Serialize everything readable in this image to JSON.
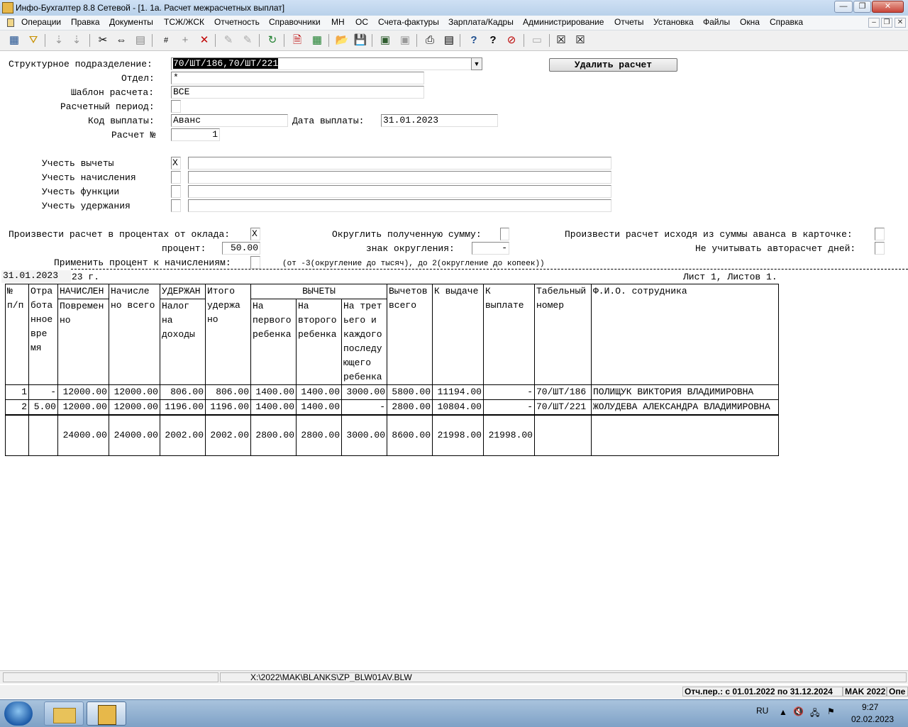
{
  "window": {
    "title": "Инфо-Бухгалтер 8.8 Сетевой - [1. 1а. Расчет межрасчетных выплат]",
    "controls": [
      "—",
      "❐",
      "✕"
    ]
  },
  "menu": [
    "Операции",
    "Правка",
    "Документы",
    "ТСЖ/ЖСК",
    "Отчетность",
    "Справочники",
    "МН",
    "ОС",
    "Счета-фактуры",
    "Зарплата/Кадры",
    "Администрирование",
    "Отчеты",
    "Установка",
    "Файлы",
    "Окна",
    "Справка"
  ],
  "mdi_controls": [
    "–",
    "❐",
    "✕"
  ],
  "toolbar": [
    {
      "name": "grid-icon",
      "glyph": "▦"
    },
    {
      "name": "filter-icon",
      "glyph": "⛛"
    },
    {
      "name": "sort-asc-icon",
      "glyph": "⇣"
    },
    {
      "name": "sort-desc-icon",
      "glyph": "⇣"
    },
    {
      "name": "copy-icon",
      "glyph": "❐"
    },
    {
      "name": "cut-icon",
      "glyph": "✂"
    },
    {
      "name": "move-icon",
      "glyph": "⇔"
    },
    {
      "name": "paste-icon",
      "glyph": "▤"
    },
    {
      "name": "number-icon",
      "glyph": "#"
    },
    {
      "name": "add-icon",
      "glyph": "+"
    },
    {
      "name": "delete-icon",
      "glyph": "✕"
    },
    {
      "name": "tool-icon",
      "glyph": "✎"
    },
    {
      "name": "tool2-icon",
      "glyph": "✎"
    },
    {
      "name": "refresh-icon",
      "glyph": "↻"
    },
    {
      "name": "document-icon",
      "glyph": "🗎"
    },
    {
      "name": "calculator-icon",
      "glyph": "▦"
    },
    {
      "name": "open-folder-icon",
      "glyph": "📂"
    },
    {
      "name": "save-icon",
      "glyph": "💾"
    },
    {
      "name": "export-icon",
      "glyph": "▣"
    },
    {
      "name": "import-icon",
      "glyph": "▣"
    },
    {
      "name": "print-icon",
      "glyph": "⎙"
    },
    {
      "name": "preview-icon",
      "glyph": "▤"
    },
    {
      "name": "help-icon",
      "glyph": "?"
    },
    {
      "name": "context-help-icon",
      "glyph": "?"
    },
    {
      "name": "compass-icon",
      "glyph": "⊘"
    },
    {
      "name": "report-icon",
      "glyph": "▭"
    },
    {
      "name": "close-doc-icon",
      "glyph": "☒"
    },
    {
      "name": "close-all-icon",
      "glyph": "☒"
    }
  ],
  "form": {
    "division_label": "Структурное подразделение:",
    "division_value": "70/ШТ/186,70/ШТ/221",
    "delete_button": "Удалить расчет",
    "dept_label": "Отдел:",
    "dept_value": "*",
    "template_label": "Шаблон расчета:",
    "template_value": "ВСЕ",
    "period_label": "Расчетный период:",
    "period_value": "",
    "paycode_label": "Код выплаты:",
    "paycode_value": "Аванс",
    "paydate_label": "Дата выплаты:",
    "paydate_value": "31.01.2023",
    "calcno_label": "Расчет №",
    "calcno_value": "1",
    "checks": [
      {
        "label": "Учесть вычеты",
        "mark": "X",
        "text": ""
      },
      {
        "label": "Учесть начисления",
        "mark": "",
        "text": ""
      },
      {
        "label": "Учесть функции",
        "mark": "",
        "text": ""
      },
      {
        "label": "Учесть удержания",
        "mark": "",
        "text": ""
      }
    ],
    "percent_calc_label": "Произвести расчет в процентах от оклада:",
    "percent_calc_mark": "X",
    "round_label": "Округлить полученную сумму:",
    "round_mark": "",
    "advance_card_label": "Произвести расчет исходя из суммы аванса в карточке:",
    "advance_card_mark": "",
    "percent_label": "процент:",
    "percent_value": "50.00",
    "round_sign_label": "знак округления:",
    "round_sign_value": "-",
    "no_autocalc_label": "Не учитывать авторасчет дней:",
    "no_autocalc_mark": "",
    "apply_percent_label": "Применить процент к начислениям:",
    "apply_percent_mark": "",
    "round_hint": "(от -3(округление до тысяч), до 2(округление до копеек))"
  },
  "report": {
    "date_field": "31.01.2023",
    "date_suffix": "23 г.",
    "sheet_info": "Лист 1, Листов 1.",
    "headers": {
      "no": "№ п/п",
      "worked": "Отра бота нное вре мя",
      "accrued_group": "НАЧИСЛЕН",
      "accrued_time": "Повремен но",
      "accrued_total": "Начисле но всего",
      "withheld_group": "УДЕРЖАН",
      "income_tax": "Налог на доходы",
      "withheld_total": "Итого удержа но",
      "deductions_group": "ВЫЧЕТЫ",
      "first_child": "На первого ребенка",
      "second_child": "На второго ребенка",
      "third_child": "На трет ьего и каждого последу ющего ребенка",
      "deductions_total": "Вычетов всего",
      "to_issue": "К выдаче",
      "to_pay": "К выплате",
      "tab_no": "Табельный номер",
      "fio": "Ф.И.О. сотрудника"
    },
    "rows": [
      [
        "1",
        "-",
        "12000.00",
        "12000.00",
        "806.00",
        "806.00",
        "1400.00",
        "1400.00",
        "3000.00",
        "5800.00",
        "11194.00",
        "-",
        "70/ШТ/186",
        "ПОЛИЩУК ВИКТОРИЯ ВЛАДИМИРОВНА"
      ],
      [
        "2",
        "5.00",
        "12000.00",
        "12000.00",
        "1196.00",
        "1196.00",
        "1400.00",
        "1400.00",
        "-",
        "2800.00",
        "10804.00",
        "-",
        "70/ШТ/221",
        "ЖОЛУДЕВА АЛЕКСАНДРА ВЛАДИМИРОВНА"
      ]
    ],
    "totals": [
      "",
      "",
      "24000.00",
      "24000.00",
      "2002.00",
      "2002.00",
      "2800.00",
      "2800.00",
      "3000.00",
      "8600.00",
      "21998.00",
      "21998.00",
      "",
      ""
    ]
  },
  "status": {
    "path": "X:\\2022\\MAK\\BLANKS\\ZP_BLW01AV.BLW",
    "period": "Отч.пер.: с 01.01.2022 по 31.12.2024",
    "org": "MAK 2022",
    "mode": "Опе"
  },
  "taskbar": {
    "lang": "RU",
    "time": "9:27",
    "date": "02.02.2023"
  }
}
